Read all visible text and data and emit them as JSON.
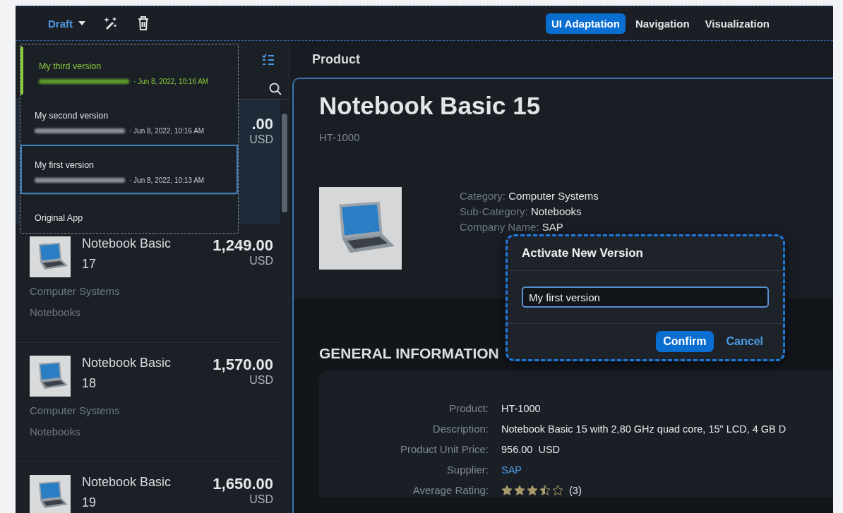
{
  "toolbar": {
    "draft_label": "Draft",
    "tabs": [
      {
        "label": "UI Adaptation",
        "selected": true
      },
      {
        "label": "Navigation",
        "selected": false
      },
      {
        "label": "Visualization",
        "selected": false
      }
    ]
  },
  "versions_popover": {
    "items": [
      {
        "title": "My third version",
        "date": "· Jun 8, 2022, 10:16 AM",
        "kind": "version",
        "active": true,
        "selected": false
      },
      {
        "title": "My second version",
        "date": "· Jun 8, 2022, 10:16 AM",
        "kind": "version",
        "active": false,
        "selected": false
      },
      {
        "title": "My first version",
        "date": "· Jun 8, 2022, 10:13 AM",
        "kind": "version",
        "active": false,
        "selected": true
      },
      {
        "title": "Original App",
        "kind": "original",
        "active": false,
        "selected": false
      }
    ]
  },
  "master_list": {
    "items": [
      {
        "price": ".00",
        "currency": "USD",
        "selected": true
      },
      {
        "title": "Notebook Basic 17",
        "price": "1,249.00",
        "currency": "USD",
        "category": "Computer Systems",
        "subcategory": "Notebooks",
        "selected": false
      },
      {
        "title": "Notebook Basic 18",
        "price": "1,570.00",
        "currency": "USD",
        "category": "Computer Systems",
        "subcategory": "Notebooks",
        "selected": false
      },
      {
        "title": "Notebook Basic 19",
        "price": "1,650.00",
        "currency": "USD",
        "selected": false
      }
    ]
  },
  "object_page": {
    "page_title": "Product",
    "title": "Notebook Basic 15",
    "subtitle": "HT-1000",
    "attributes": [
      {
        "label": "Category:",
        "value": "Computer Systems"
      },
      {
        "label": "Sub-Category:",
        "value": "Notebooks"
      },
      {
        "label": "Company Name:",
        "value": "SAP"
      }
    ],
    "section": {
      "title": "GENERAL INFORMATION",
      "fields": [
        {
          "label": "Product:",
          "value": "HT-1000",
          "kind": "text"
        },
        {
          "label": "Description:",
          "value": "Notebook Basic 15 with 2,80 GHz quad core, 15\" LCD, 4 GB D",
          "kind": "text"
        },
        {
          "label": "Product Unit Price:",
          "value": "956.00  USD",
          "kind": "text"
        },
        {
          "label": "Supplier:",
          "value": "SAP",
          "kind": "link"
        },
        {
          "label": "Average Rating:",
          "value": "(3)",
          "kind": "rating",
          "stars": 3.5
        }
      ]
    }
  },
  "dialog": {
    "title": "Activate New Version",
    "input_value": "My first version",
    "buttons": [
      {
        "label": "Confirm",
        "kind": "emphasized"
      },
      {
        "label": "Cancel",
        "kind": "transparent"
      }
    ]
  }
}
